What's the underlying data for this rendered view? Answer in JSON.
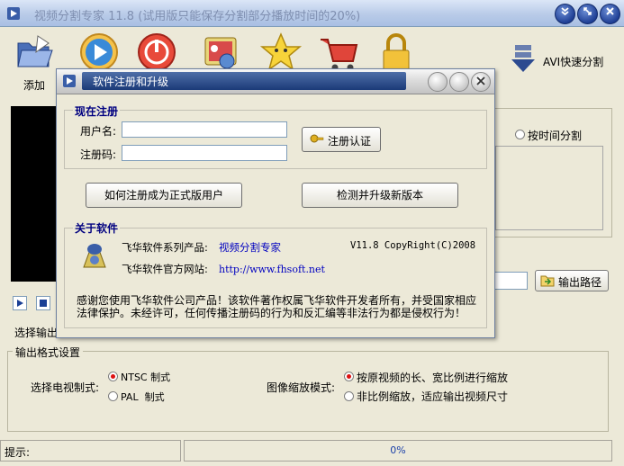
{
  "window": {
    "title": "视频分割专家 11.8 (试用版只能保存分割部分播放时间的20%)",
    "controls": [
      "minimize",
      "restore",
      "close"
    ]
  },
  "toolbar": {
    "add_label": "添加",
    "avi_split_label": "AVI快速分割",
    "icons": [
      "folder-open-icon",
      "play-icon",
      "stop-icon",
      "settings-icon",
      "star-icon",
      "cart-icon",
      "lock-icon"
    ]
  },
  "right_panel": {
    "by_time_label": "按时间分割",
    "output_path_button": "输出路径"
  },
  "left": {
    "select_output_label": "选择输出"
  },
  "format_group": {
    "legend": "输出格式设置",
    "tv_label": "选择电视制式:",
    "ntsc_label": "NTSC 制式",
    "pal_label": "PAL  制式",
    "scale_label": "图像缩放模式:",
    "scale_keep_label": "按原视频的长、宽比例进行缩放",
    "scale_fit_label": "非比例缩放，适应输出视频尺寸",
    "ntsc_selected": true,
    "scale_keep_selected": true
  },
  "status": {
    "hint_label": "提示:",
    "progress_text": "0%",
    "progress_value": 0
  },
  "dialog": {
    "title": "软件注册和升级",
    "register_section": "现在注册",
    "username_label": "用户名:",
    "username_value": "",
    "code_label": "注册码:",
    "code_value": "",
    "verify_button": "注册认证",
    "how_to_button": "如何注册成为正式版用户",
    "check_update_button": "检测并升级新版本",
    "about_section": "关于软件",
    "product_label": "飞华软件系列产品:",
    "product_name": "视频分割专家",
    "version_text": "V11.8 CopyRight(C)2008",
    "website_label": "飞华软件官方网站:",
    "website_url": "http://www.fhsoft.net",
    "thanks_text": "感谢您使用飞华软件公司产品！该软件著作权属飞华软件开发者所有，并受国家相应法律保护。未经许可，任何传播注册码的行为和反汇编等非法行为都是侵权行为！"
  },
  "colors": {
    "title_bar": "#b9cbe8",
    "dialog_title_bar": "#1b3a78",
    "section_title": "#000080",
    "link": "#0000c0",
    "radio_dot": "#dd1111"
  }
}
